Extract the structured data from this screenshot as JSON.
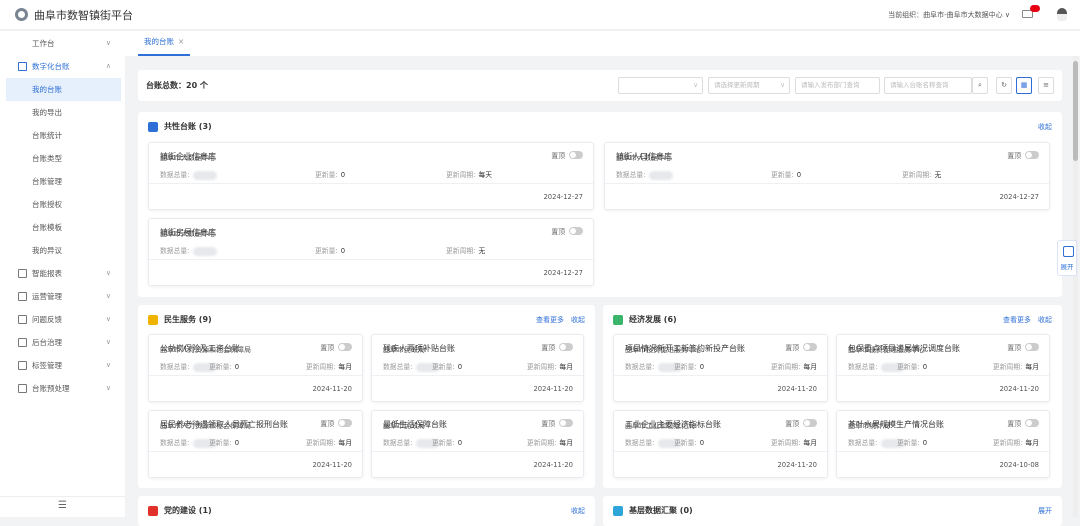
{
  "header": {
    "title": "曲阜市数智镇街平台",
    "org": "当前组织：曲阜市-曲阜市大数据中心 ∨"
  },
  "sidebar": {
    "items": [
      {
        "label": "工作台",
        "chev": "∨"
      },
      {
        "label": "数字化台账",
        "chev": "∧",
        "open": true,
        "children": [
          "我的台账",
          "我的导出",
          "台账统计",
          "台账类型",
          "台账管理",
          "台账授权",
          "台账模板",
          "我的异议"
        ]
      },
      {
        "label": "智能报表",
        "chev": "∨"
      },
      {
        "label": "运营管理",
        "chev": "∨"
      },
      {
        "label": "问题反馈",
        "chev": "∨"
      },
      {
        "label": "后台治理",
        "chev": "∨"
      },
      {
        "label": "标签管理",
        "chev": "∨"
      },
      {
        "label": "台账预处理",
        "chev": "∨"
      }
    ],
    "collapse": "☰"
  },
  "tabs": [
    {
      "label": "我的台账",
      "close": "×"
    }
  ],
  "toolbar": {
    "total": "台账总数：20 个",
    "select1": "",
    "select2_placeholder": "请选择更新周期",
    "dept_placeholder": "请输入发布部门查询",
    "name_placeholder": "请输入台账名称查询",
    "search": "⌕",
    "refresh": "↻",
    "grid": "▦",
    "list": "≡"
  },
  "labels": {
    "pin": "置顶",
    "total": "数据总量:",
    "updated": "更新量:",
    "period": "更新周期:",
    "more": "查看更多",
    "collapse": "收起",
    "expand": "展开"
  },
  "float_expand": "展开",
  "sections": [
    {
      "title": "共性台账 (3)",
      "color": "#2d6fd6",
      "links": [
        "收起"
      ],
      "cards": [
        {
          "title": "镇街企业信息库",
          "updated": "0",
          "period": "每天",
          "org": "曲阜市大数据中心",
          "date": "2024-12-27"
        },
        {
          "title": "镇街人口信息库",
          "updated": "0",
          "period": "无",
          "org": "曲阜市大数据中心",
          "date": "2024-12-27"
        },
        {
          "title": "镇街房屋信息库",
          "updated": "0",
          "period": "无",
          "org": "曲阜市大数据中心",
          "date": "2024-12-27"
        }
      ]
    },
    {
      "title": "民生服务 (9)",
      "color": "#f0b400",
      "links": [
        "查看更多",
        "收起"
      ],
      "cards": [
        {
          "title": "公益岗保险及工资台账",
          "updated": "0",
          "period": "每月",
          "org": "曲阜市人力资源和社会保障局",
          "date": "2024-11-20"
        },
        {
          "title": "残疾人两项补贴台账",
          "updated": "0",
          "period": "每月",
          "org": "曲阜市民政局",
          "date": "2024-11-20"
        },
        {
          "title": "居民养老待遇领取人员死亡报刑台账",
          "updated": "0",
          "period": "每月",
          "org": "曲阜市人力资源和社会保障局",
          "date": "2024-11-20"
        },
        {
          "title": "最低生活保障台账",
          "updated": "0",
          "period": "每月",
          "org": "曲阜市民政局",
          "date": "2024-11-20"
        }
      ]
    },
    {
      "title": "经济发展 (6)",
      "color": "#3bb56b",
      "links": [
        "查看更多",
        "收起"
      ],
      "cards": [
        {
          "title": "项目情况新开工新签约新投产台账",
          "updated": "0",
          "period": "每月",
          "org": "曲阜市投资促进服务中心",
          "date": "2024-11-20"
        },
        {
          "title": "包保重点项目进展情况调度台账",
          "updated": "0",
          "period": "每月",
          "org": "曲阜市投资促进服务中心",
          "date": "2024-11-20"
        },
        {
          "title": "工业企业主要经济指标台账",
          "updated": "0",
          "period": "每月",
          "org": "曲阜市工业和信息化局",
          "date": "2024-11-20"
        },
        {
          "title": "茶叶水果规模生产情况台账",
          "updated": "0",
          "period": "每月",
          "org": "曲阜市统计局",
          "date": "2024-10-08"
        }
      ]
    },
    {
      "title": "党的建设 (1)",
      "color": "#e0302a",
      "links": [
        "收起"
      ],
      "cards": []
    },
    {
      "title": "基层数据汇聚 (0)",
      "color": "#2fa6d9",
      "links": [
        "展开"
      ],
      "cards": []
    }
  ]
}
